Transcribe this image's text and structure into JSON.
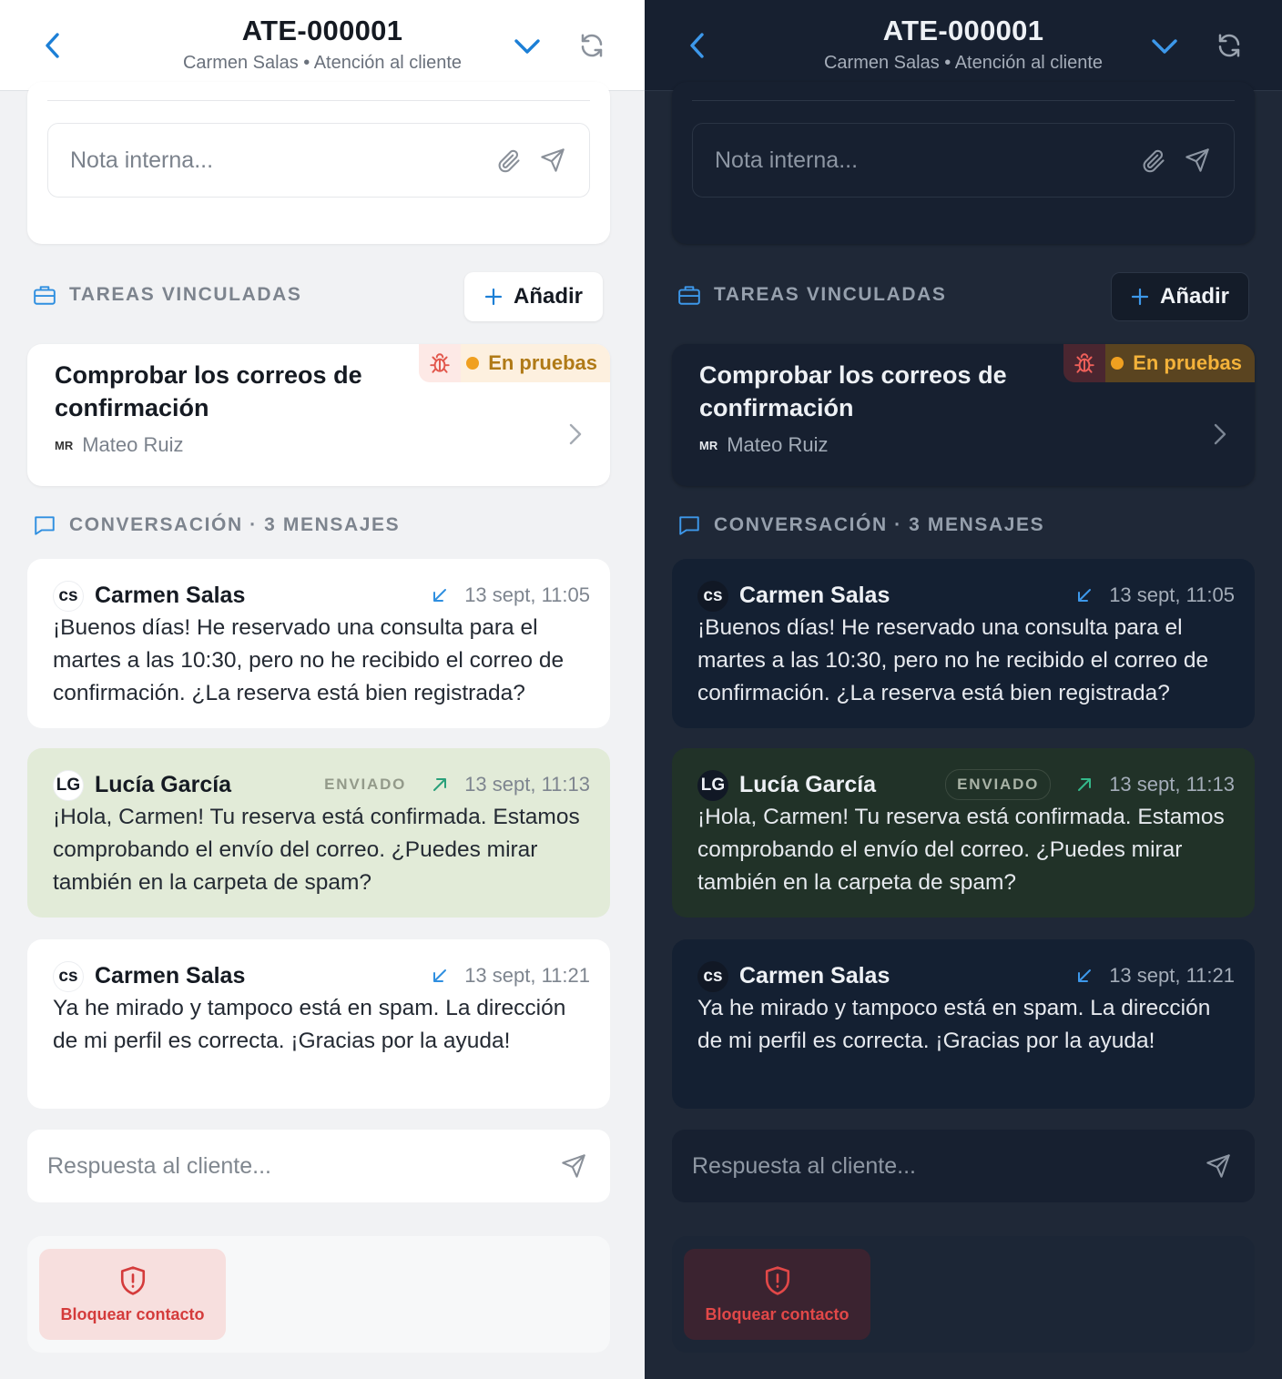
{
  "header": {
    "title": "ATE-000001",
    "subtitle": "Carmen Salas • Atención al cliente"
  },
  "note": {
    "placeholder": "Nota interna..."
  },
  "tasks": {
    "section_title": "TAREAS VINCULADAS",
    "add_label": "Añadir",
    "items": [
      {
        "title": "Comprobar los correos de confirmación",
        "status": "En pruebas",
        "assignee_initials": "MR",
        "assignee": "Mateo Ruiz"
      }
    ]
  },
  "conversation": {
    "section_title": "CONVERSACIÓN · 3 MENSAJES",
    "messages": [
      {
        "initials": "CS",
        "author": "Carmen Salas",
        "time": "13 sept, 11:05",
        "direction": "incoming",
        "text": "¡Buenos días! He reservado una consulta para el martes a las 10:30, pero no he recibido el correo de confirmación. ¿La reserva está bien registrada?"
      },
      {
        "initials": "LG",
        "author": "Lucía García",
        "tag": "ENVIADO",
        "time": "13 sept, 11:13",
        "direction": "outgoing",
        "text": "¡Hola, Carmen! Tu reserva está confirmada. Estamos comprobando el envío del correo. ¿Puedes mirar también en la carpeta de spam?"
      },
      {
        "initials": "CS",
        "author": "Carmen Salas",
        "time": "13 sept, 11:21",
        "direction": "incoming",
        "text": "Ya he mirado y tampoco está en spam. La dirección de mi perfil es correcta. ¡Gracias por la ayuda!"
      }
    ]
  },
  "reply": {
    "placeholder": "Respuesta al cliente..."
  },
  "actions": {
    "block_label": "Bloquear contacto"
  },
  "colors": {
    "accent": "#1c7fd6",
    "incoming_arrow": "#2f8fe0",
    "outgoing_arrow": "#2aa07a",
    "status_dot": "#f0a020",
    "danger": "#d43b3b"
  },
  "icons": [
    "back-icon",
    "chevron-down-icon",
    "refresh-icon",
    "paperclip-icon",
    "send-icon",
    "briefcase-icon",
    "plus-icon",
    "bug-icon",
    "chevron-right-icon",
    "chat-icon",
    "incoming-arrow-icon",
    "outgoing-arrow-icon",
    "shield-alert-icon"
  ]
}
